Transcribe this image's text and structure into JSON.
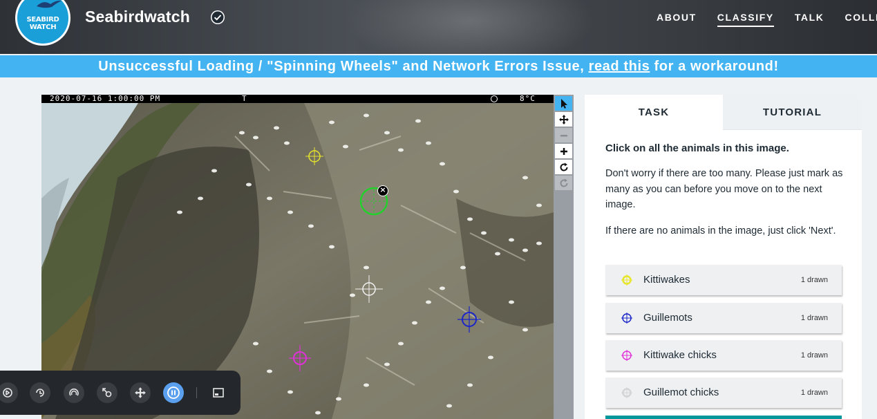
{
  "header": {
    "logo_text_line1": "SEABIRD",
    "logo_text_line2": "WATCH",
    "project_name": "Seabirdwatch",
    "nav": [
      "ABOUT",
      "CLASSIFY",
      "TALK",
      "COLLECT"
    ],
    "active_nav": "CLASSIFY"
  },
  "banner": {
    "prefix": "Unsuccessful Loading / \"Spinning Wheels\" and Network Errors Issue, ",
    "link": "read this",
    "suffix": " for a workaround!"
  },
  "subject": {
    "timestamp": "2020-07-16 1:00:00 PM",
    "mode": "T",
    "temperature": "8°C"
  },
  "tools": [
    {
      "name": "pointer",
      "active": true
    },
    {
      "name": "move",
      "active": false
    },
    {
      "name": "zoom-out",
      "disabled": true
    },
    {
      "name": "zoom-in",
      "active": false
    },
    {
      "name": "rotate",
      "active": false
    },
    {
      "name": "reset",
      "disabled": true
    }
  ],
  "player": {
    "buttons": [
      "rewind",
      "replay",
      "loop",
      "speed",
      "move",
      "pause",
      "screen"
    ]
  },
  "task": {
    "tabs": {
      "task": "TASK",
      "tutorial": "TUTORIAL"
    },
    "question": "Click on all the animals in this image.",
    "help1": "Don't worry if there are too many. Please just mark as many as you can before you move on to the next image.",
    "help2": "If there are no animals in the image, just click 'Next'.",
    "choices": [
      {
        "label": "Kittiwakes",
        "count": "1 drawn",
        "color": "#e8e62a"
      },
      {
        "label": "Guillemots",
        "count": "1 drawn",
        "color": "#1a24c8"
      },
      {
        "label": "Kittiwake chicks",
        "count": "1 drawn",
        "color": "#e030d8"
      },
      {
        "label": "Guillemot chicks",
        "count": "1 drawn",
        "color": "#e0e0e0"
      }
    ]
  },
  "colors": {
    "brand": "#43b3f2",
    "next_button": "#00979d"
  }
}
